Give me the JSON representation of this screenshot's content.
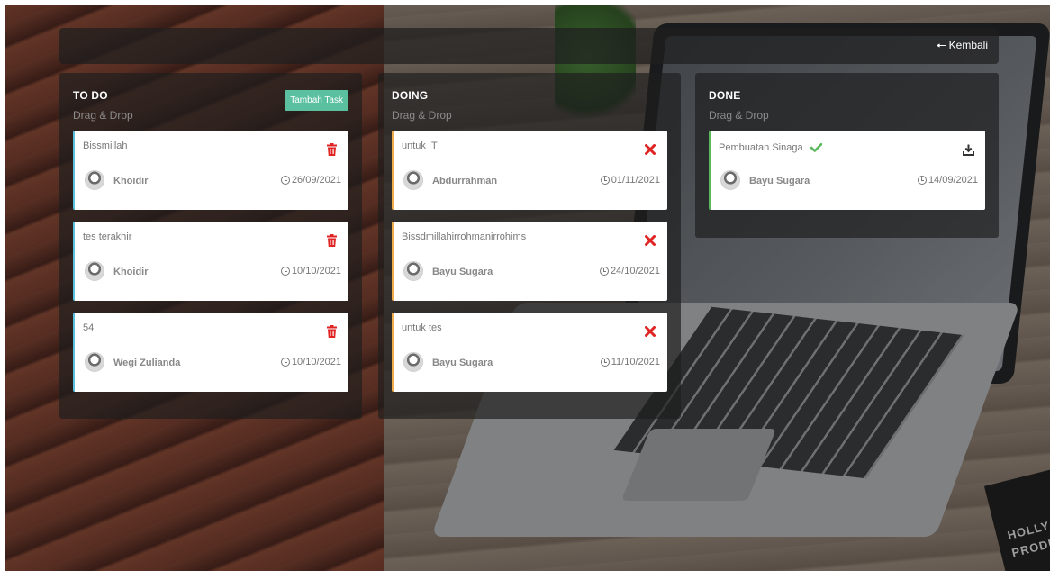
{
  "nav": {
    "back_label": "Kembali"
  },
  "columns": {
    "todo": {
      "title": "TO DO",
      "subtitle": "Drag & Drop",
      "add_button": "Tambah Task",
      "cards": [
        {
          "title": "Bissmillah",
          "assignee": "Khoidir",
          "date": "26/09/2021",
          "action_icon": "trash-icon"
        },
        {
          "title": "tes terakhir",
          "assignee": "Khoidir",
          "date": "10/10/2021",
          "action_icon": "trash-icon"
        },
        {
          "title": "54",
          "assignee": "Wegi Zulianda",
          "date": "10/10/2021",
          "action_icon": "trash-icon"
        }
      ]
    },
    "doing": {
      "title": "DOING",
      "subtitle": "Drag & Drop",
      "cards": [
        {
          "title": "untuk IT",
          "assignee": "Abdurrahman",
          "date": "01/11/2021",
          "action_icon": "close-icon"
        },
        {
          "title": "Bissdmillahirrohmanirrohims",
          "assignee": "Bayu Sugara",
          "date": "24/10/2021",
          "action_icon": "close-icon"
        },
        {
          "title": "untuk tes",
          "assignee": "Bayu Sugara",
          "date": "11/10/2021",
          "action_icon": "close-icon"
        }
      ]
    },
    "done": {
      "title": "DONE",
      "subtitle": "Drag & Drop",
      "cards": [
        {
          "title": "Pembuatan Sinaga",
          "assignee": "Bayu Sugara",
          "date": "14/09/2021",
          "action_icon": "download-icon",
          "status_icon": "check-icon"
        }
      ]
    }
  },
  "background_sign": [
    "HOLLY",
    "PRODUC"
  ],
  "colors": {
    "add_button": "#5bc0a0",
    "todo_accent": "#5bc0de",
    "doing_accent": "#f0ad4e",
    "done_accent": "#5cb85c",
    "delete_red": "#e02424"
  }
}
